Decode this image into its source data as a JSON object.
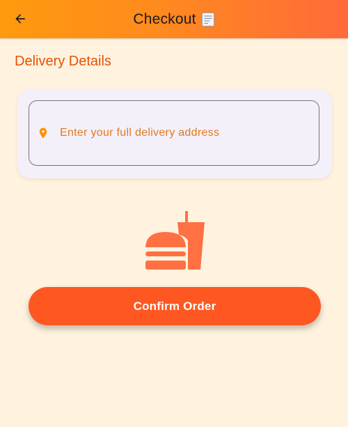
{
  "appbar": {
    "title": "Checkout",
    "back_icon": "arrow-left-icon",
    "title_icon": "receipt-icon"
  },
  "delivery": {
    "heading": "Delivery Details",
    "address_placeholder": "Enter your full delivery address",
    "address_value": "",
    "pin_icon": "location-pin-icon"
  },
  "illustration": {
    "icon": "fastfood-icon"
  },
  "actions": {
    "confirm_label": "Confirm Order"
  },
  "colors": {
    "appbar_gradient_start": "#FF9A0E",
    "appbar_gradient_end": "#FF6A3A",
    "background": "#FFF3E0",
    "accent": "#E65100",
    "button": "#FF5722",
    "icon": "#FF7043",
    "card": "#F4F0FA"
  }
}
